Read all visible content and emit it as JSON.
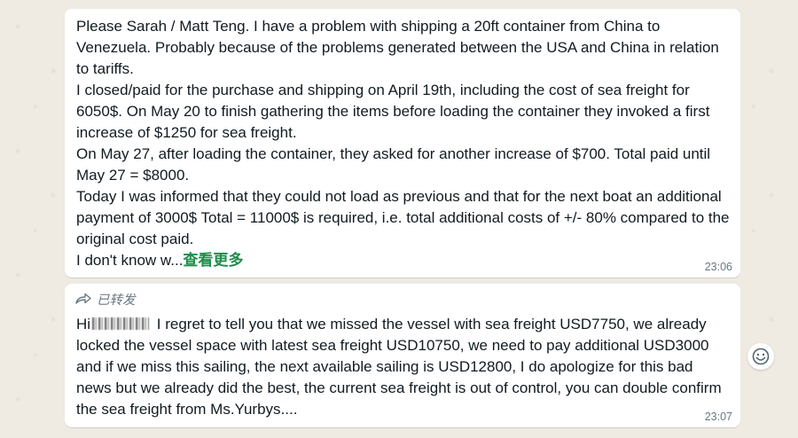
{
  "messages": [
    {
      "text": "Please Sarah / Matt Teng. I have a problem with shipping a 20ft container from China to Venezuela. Probably because of the problems generated between the USA and China in relation to tariffs.\nI closed/paid for the purchase and shipping on April 19th, including the cost of sea freight for 6050$. On May 20 to finish gathering the items before loading the container they invoked a first increase of $1250 for sea freight.\nOn May 27, after loading the container, they asked for another increase of $700. Total paid until May 27 = $8000.\nToday I was informed that they could not load as previous and that for the next boat an additional payment of 3000$ Total = 11000$ is required, i.e. total additional costs of +/- 80% compared to the original cost paid.\nI don't know w...",
      "read_more": "查看更多",
      "time": "23:06"
    },
    {
      "forwarded_label": "已转发",
      "greeting": "Hi",
      "text": " I regret to tell you that we missed the vessel with sea freight USD7750, we already locked the vessel space with latest sea freight USD10750, we need to pay additional USD3000 and if we miss this sailing, the next available sailing is USD12800, I do apologize for this bad news but we already did the best, the current sea freight is out of control, you can double confirm the sea freight from Ms.Yurbys....",
      "time": "23:07"
    }
  ],
  "icons": {
    "forwarded": "forward-arrow-icon",
    "reaction": "smiley-icon"
  },
  "colors": {
    "background": "#efeae2",
    "bubble": "#ffffff",
    "read_more": "#1d8d4b",
    "meta": "#667781"
  }
}
